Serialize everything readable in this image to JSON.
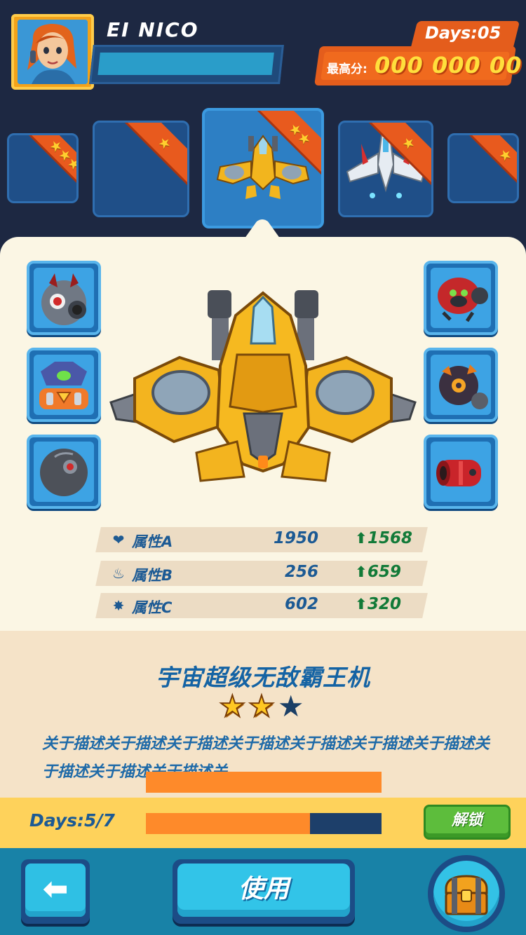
{
  "player": {
    "name": "EI NICO",
    "days_label": "Days:05",
    "best_score_label": "最高分:",
    "best_score_value": "000 000 00"
  },
  "carousel": {
    "slots": [
      {
        "stars": 3,
        "label": "plane-slot-1"
      },
      {
        "stars": 1,
        "label": "plane-slot-2"
      },
      {
        "stars": 2,
        "label": "plane-slot-3-selected"
      },
      {
        "stars": 1,
        "label": "plane-slot-4"
      },
      {
        "stars": 1,
        "label": "plane-slot-5"
      }
    ]
  },
  "skills_left": [
    "robot-head-icon",
    "mech-turret-icon",
    "bomb-orb-icon"
  ],
  "skills_right": [
    "red-drone-icon",
    "dark-bot-icon",
    "red-cannon-icon"
  ],
  "stats": [
    {
      "icon": "heart-icon",
      "glyph": "❤",
      "label": "属性A",
      "value": "1950",
      "boost": "1568"
    },
    {
      "icon": "flame-icon",
      "glyph": "♨",
      "label": "属性B",
      "value": "256",
      "boost": "659"
    },
    {
      "icon": "burst-icon",
      "glyph": "✸",
      "label": "属性C",
      "value": "602",
      "boost": "320"
    }
  ],
  "plane": {
    "title": "宇宙超级无敌霸王机",
    "rating": 2,
    "rating_max": 3,
    "description": "关于描述关于描述关于描述关于描述关于描述关于描述关于描述关于描述关于描述关于描述关"
  },
  "progress": {
    "label": "Days:5/7",
    "fraction": 0.6964,
    "unlock_label": "解锁"
  },
  "bottom": {
    "back_glyph": "⬅",
    "use_label": "使用"
  },
  "colors": {
    "background": "#1d2842",
    "accent_orange": "#e85a1e",
    "accent_blue": "#2d7fc4",
    "star_gold": "#ffc823",
    "boost_green": "#127a38"
  }
}
